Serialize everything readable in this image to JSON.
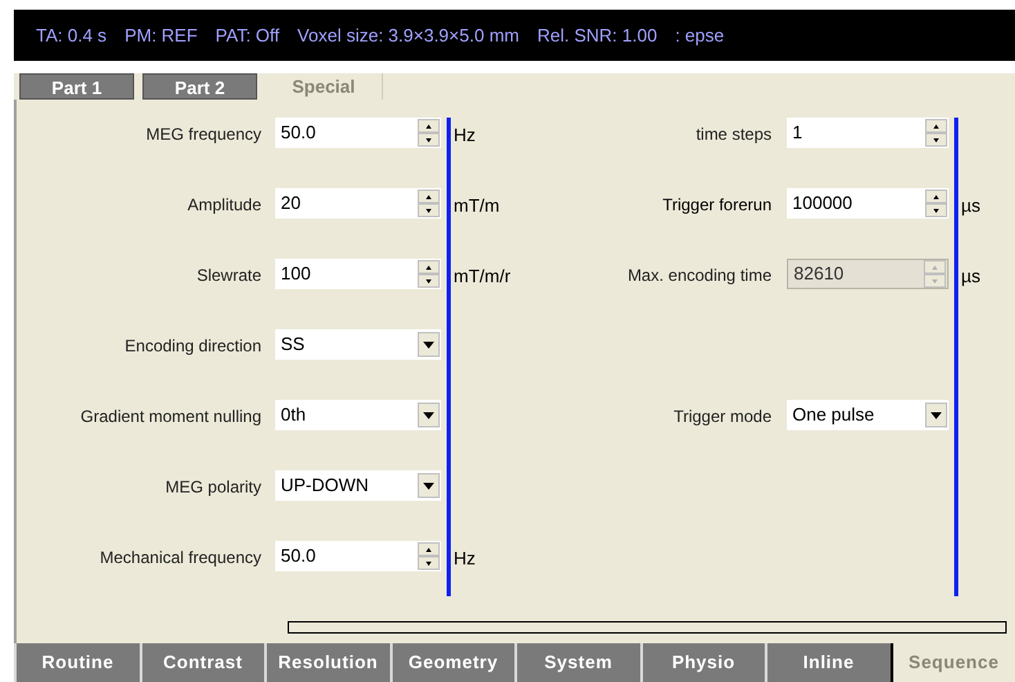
{
  "status_bar": [
    {
      "text": "TA: 0.4 s"
    },
    {
      "text": "PM: REF"
    },
    {
      "text": "PAT: Off"
    },
    {
      "text": "Voxel size: 3.9×3.9×5.0 mm"
    },
    {
      "text": "Rel. SNR: 1.00"
    },
    {
      "text": ": epse"
    }
  ],
  "sub_tabs": [
    {
      "label": "Part 1",
      "selected": false
    },
    {
      "label": "Part 2",
      "selected": false
    },
    {
      "label": "Special",
      "selected": true
    }
  ],
  "rows": [
    {
      "left": {
        "kind": "spin",
        "label": "MEG frequency",
        "value": "50.0",
        "unit": "Hz",
        "disabled": false
      },
      "right": {
        "kind": "spin",
        "label": "time steps",
        "value": "1",
        "disabled": false
      }
    },
    {
      "left": {
        "kind": "spin",
        "label": "Amplitude",
        "value": "20",
        "unit": "mT/m",
        "disabled": false
      },
      "right": {
        "kind": "spin",
        "label": "Trigger forerun",
        "value": "100000",
        "unit": "µs",
        "disabled": false
      }
    },
    {
      "left": {
        "kind": "spin",
        "label": "Slewrate",
        "value": "100",
        "unit": "mT/m/r",
        "disabled": false
      },
      "right": {
        "kind": "spin",
        "label": "Max. encoding time",
        "value": "82610",
        "unit": "µs",
        "disabled": true
      }
    },
    {
      "left": {
        "kind": "combo",
        "label": "Encoding direction",
        "value": "SS",
        "disabled": false
      }
    },
    {
      "left": {
        "kind": "combo",
        "label": "Gradient moment nulling",
        "value": "0th",
        "disabled": false
      },
      "right": {
        "kind": "combo",
        "label": "Trigger mode",
        "value": "One pulse",
        "disabled": false
      }
    },
    {
      "left": {
        "kind": "combo",
        "label": "MEG polarity",
        "value": "UP-DOWN",
        "disabled": false
      }
    },
    {
      "left": {
        "kind": "spin",
        "label": "Mechanical frequency",
        "value": "50.0",
        "unit": "Hz",
        "disabled": false
      }
    }
  ],
  "main_tabs": [
    {
      "label": "Routine",
      "selected": false
    },
    {
      "label": "Contrast",
      "selected": false
    },
    {
      "label": "Resolution",
      "selected": false
    },
    {
      "label": "Geometry",
      "selected": false
    },
    {
      "label": "System",
      "selected": false
    },
    {
      "label": "Physio",
      "selected": false
    },
    {
      "label": "Inline",
      "selected": false
    },
    {
      "label": "Sequence",
      "selected": true
    }
  ]
}
